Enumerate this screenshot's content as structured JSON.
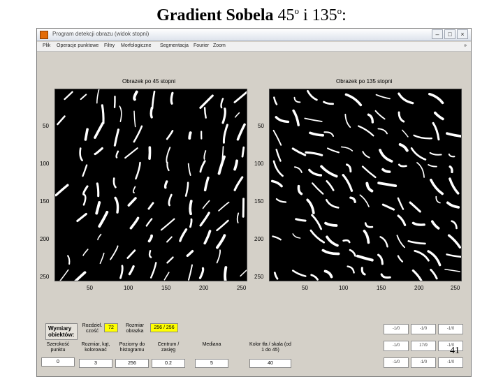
{
  "slide": {
    "title_bold": "Gradient Sobela",
    "title_rest": "45",
    "title_sup1": "o",
    "title_mid": " i 135",
    "title_sup2": "o",
    "title_end": ":",
    "page_number": "41"
  },
  "window": {
    "title": "Program detekcji obrazu (widok stopni)",
    "menu": [
      "Plik",
      "Operacje punktowe",
      "Filtry",
      "Morfologiczne",
      "Segmentacja",
      "Fourier",
      "Zoom"
    ],
    "more": "»"
  },
  "axes_left": {
    "title": "Obrazek po 45 stopni",
    "yticks": [
      "50",
      "100",
      "150",
      "200",
      "250"
    ],
    "xticks": [
      "50",
      "100",
      "150",
      "200",
      "250"
    ]
  },
  "axes_right": {
    "title": "Obrazek po 135 stopni",
    "yticks": [
      "50",
      "100",
      "150",
      "200",
      "250"
    ],
    "xticks": [
      "50",
      "100",
      "150",
      "200",
      "250"
    ]
  },
  "controls": {
    "wymiary_label": "Wymiary obiektów:",
    "rozdzielczosc_label": "Rozdziel. czość",
    "rozdzielczosc_value": "72",
    "rozmiar_label": "Rozmiar obrazka",
    "rozmiar_value": "256 / 256",
    "szerokosc_label": "Szerokość punktu",
    "szerokosc_value": "0",
    "rozmiar_kat_label": "Rozmiar, kąt, kolorować",
    "rozmiar_kat_value": "3",
    "poziomy_label": "Poziomy do histogramu",
    "poziomy_value": "256",
    "centrum_label": "Centrum / zasięg",
    "centrum_value": "0.2",
    "mediana_label": "Mediana",
    "mediana_value": "5",
    "kolor_label": "Kolor tła / skala (od 1 do 45)",
    "kolor_value": "40"
  },
  "kernel_buttons": [
    [
      "-1/0",
      "-1/0",
      "-1/0"
    ],
    [
      "-1/0",
      "17/9",
      "-1/0"
    ],
    [
      "-1/0",
      "-1/0",
      "-1/0"
    ]
  ]
}
